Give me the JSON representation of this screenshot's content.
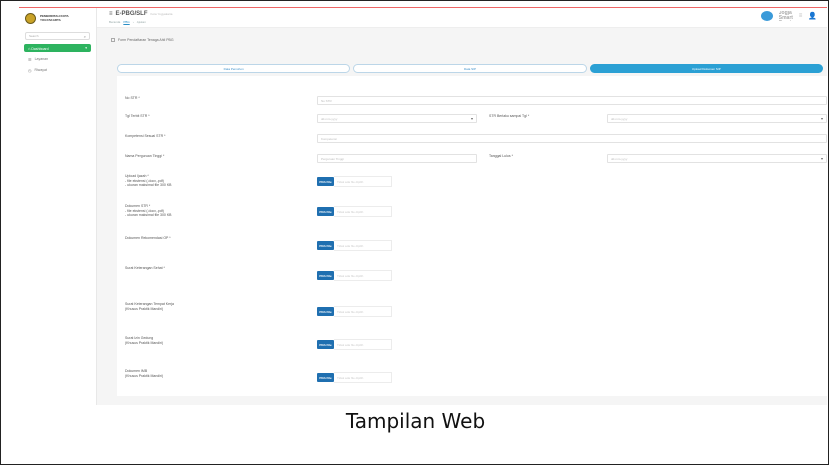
{
  "sidebar": {
    "logo_line1": "PEMERINTAH KOTA",
    "logo_line2": "YOGYAKARTA",
    "search_placeholder": "Search",
    "items": [
      {
        "label": "Dashboard",
        "active": true
      },
      {
        "label": "Layanan",
        "active": false
      },
      {
        "label": "Riwayat",
        "active": false
      }
    ]
  },
  "topbar": {
    "title": "E-PBG/SLF",
    "subtitle": "Kota Yogyakarta",
    "breadcrumb": [
      "Beranda",
      "PBG",
      "Ajukan"
    ],
    "brand_text": "Jogja Smart Service",
    "colors": {
      "accent": "#2ba0d4",
      "active_green": "#2db35f",
      "upload_btn": "#1f6fb0"
    }
  },
  "main": {
    "note": "Form Pendaftaran Tenaga Ahli PBG",
    "tabs": [
      {
        "label": "Data Pemohon",
        "active": false
      },
      {
        "label": "Data SIP",
        "active": false
      },
      {
        "label": "Upload Dokumen SIP",
        "active": true
      }
    ],
    "form": {
      "fields": [
        {
          "label": "No STR *",
          "placeholder": "No STR"
        },
        {
          "label": "Tgl Terbit STR *",
          "placeholder": "dd-mm-yyyy"
        },
        {
          "label": "STR Berlaku sampai Tgl *",
          "placeholder": "dd-mm-yyyy"
        },
        {
          "label": "Kompetensi Sesuai STR *",
          "placeholder": "Kompetensi"
        },
        {
          "label": "Nama Perguruan Tinggi *",
          "placeholder": "Perguruan Tinggi"
        },
        {
          "label": "Tanggal Lulus *",
          "placeholder": "dd-mm-yyyy"
        }
      ],
      "uploads": [
        {
          "label": "Upload Ijazah *\n- file ekstensi (.docx,.pdf)\n- ukuran maksimal file 300 KB",
          "button": "Pilih File",
          "filename": "Tidak ada file dipilih"
        },
        {
          "label": "Dokumen STR *\n- file ekstensi (.docx,.pdf)\n- ukuran maksimal file 300 KB",
          "button": "Pilih File",
          "filename": "Tidak ada file dipilih"
        },
        {
          "label": "Dokumen Rekomendasi OP *",
          "button": "Pilih File",
          "filename": "Tidak ada file dipilih"
        },
        {
          "label": "Surat Keterangan Sehat *",
          "button": "Pilih File",
          "filename": "Tidak ada file dipilih"
        },
        {
          "label": "Surat Keterangan Tempat Kerja\n(Khusus Praktik Mandiri)",
          "button": "Pilih File",
          "filename": "Tidak ada file dipilih"
        },
        {
          "label": "Surat Izin Gedung\n(Khusus Praktik Mandiri)",
          "button": "Pilih File",
          "filename": "Tidak ada file dipilih"
        },
        {
          "label": "Dokumen IMB\n(Khusus Praktik Mandiri)",
          "button": "Pilih File",
          "filename": "Tidak ada file dipilih"
        }
      ]
    }
  },
  "caption": "Tampilan Web"
}
